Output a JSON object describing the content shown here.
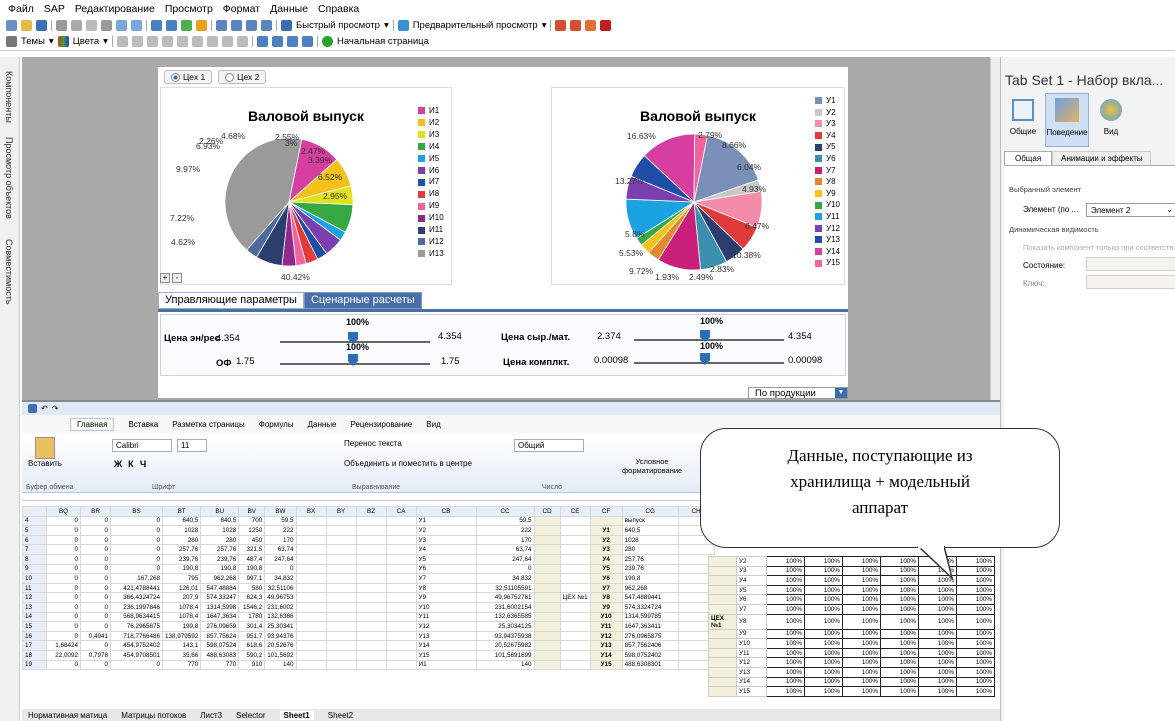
{
  "menu": [
    "Файл",
    "SAP",
    "Редактирование",
    "Просмотр",
    "Формат",
    "Данные",
    "Справка"
  ],
  "toolbar1": {
    "quick_view": "Быстрый просмотр",
    "preview": "Предварительный просмотр"
  },
  "toolbar2": {
    "themes": "Темы",
    "colors": "Цвета",
    "start_page": "Начальная страница"
  },
  "left_panel": [
    "Компоненты",
    "Просмотр объектов",
    "Совместимость"
  ],
  "tabset": {
    "radio1": "Цех 1",
    "radio2": "Цех 2"
  },
  "chart1": {
    "title": "Валовой выпуск",
    "labels": [
      "2.26%",
      "4.68%",
      "2.55%",
      "3%",
      "2.47%",
      "3.39%",
      "6.52%",
      "2.95%",
      "40.42%",
      "4.62%",
      "7.22%",
      "9.97%",
      "6.93%"
    ],
    "legend": [
      "И1",
      "И2",
      "И3",
      "И4",
      "И5",
      "И6",
      "И7",
      "И8",
      "И9",
      "И10",
      "И11",
      "И12",
      "И13"
    ]
  },
  "chart2": {
    "title": "Валовой выпуск",
    "labels": [
      "2.79%",
      "8.66%",
      "6.04%",
      "4.93%",
      "6.47%",
      "10.38%",
      "2.83%",
      "2.49%",
      "1.93%",
      "9.72%",
      "5.53%",
      "5.8%",
      "13.27%",
      "16.63%"
    ],
    "legend": [
      "У1",
      "У2",
      "У3",
      "У4",
      "У5",
      "У6",
      "У7",
      "У8",
      "У9",
      "У10",
      "У11",
      "У12",
      "У13",
      "У14",
      "У15"
    ]
  },
  "chart_data": [
    {
      "type": "pie",
      "title": "Валовой выпуск",
      "categories": [
        "И1",
        "И2",
        "И3",
        "И4",
        "И5",
        "И6",
        "И7",
        "И8",
        "И9",
        "И10",
        "И11",
        "И12",
        "И13"
      ],
      "values": [
        9.97,
        7.22,
        4.62,
        6.93,
        2.26,
        4.68,
        2.55,
        3,
        2.47,
        3.39,
        6.52,
        2.95,
        40.42
      ],
      "colors": [
        "#d63fa0",
        "#f2c21b",
        "#e2e21b",
        "#38a845",
        "#1aa3e0",
        "#7b3fb0",
        "#1f4ea8",
        "#e23b3b",
        "#f0649e",
        "#8e2a8e",
        "#2c3e70",
        "#4d6a9a",
        "#9a9a9a"
      ]
    },
    {
      "type": "pie",
      "title": "Валовой выпуск",
      "categories": [
        "У1",
        "У2",
        "У3",
        "У4",
        "У5",
        "У6",
        "У7",
        "У8",
        "У9",
        "У10",
        "У11",
        "У12",
        "У13",
        "У14",
        "У15"
      ],
      "values": [
        16.63,
        2.79,
        8.66,
        6.04,
        4.93,
        6.47,
        10.38,
        2.83,
        2.49,
        1.93,
        9.72,
        5.53,
        5.8,
        13.27,
        3.03
      ],
      "colors": [
        "#7a8fb8",
        "#c8c8c8",
        "#f28ca8",
        "#e03b3b",
        "#2c3e70",
        "#3d8fb0",
        "#c71f7a",
        "#e28a2b",
        "#f2c21b",
        "#38a845",
        "#1aa3e0",
        "#7b3fb0",
        "#1f4ea8",
        "#d63fa0",
        "#f0649e"
      ]
    }
  ],
  "ctrl": {
    "tab1": "Управляющие параметры",
    "tab2": "Сценарные расчеты",
    "pct": "100%",
    "s1_label": "Цена эн/рес",
    "s1_min": "4.354",
    "s1_max": "4.354",
    "s2_label": "ОФ",
    "s2_min": "1.75",
    "s2_max": "1.75",
    "s3_label": "Цена сыр./мат.",
    "s3_min": "2.374",
    "s3_max": "4.354",
    "s4_label": "Цена комплкт.",
    "s4_min": "0.00098",
    "s4_max": "0.00098",
    "dropdown": "По продукции"
  },
  "rpanel": {
    "title": "Tab Set 1 - Набор вкла...",
    "tab_general": "Общие",
    "tab_behavior": "Поведение",
    "tab_view": "Вид",
    "sub1": "Общая",
    "sub2": "Анимации и эффекты",
    "sel_elem": "Выбранный элемент",
    "elem_label": "Элемент (по ...",
    "elem_value": "Элемент 2",
    "dyn": "Динамическая видимость",
    "show_only": "Показать компонент только при соответств.",
    "state": "Состояние:",
    "key": "Ключ:"
  },
  "excel": {
    "tabs": [
      "Главная",
      "Вставка",
      "Разметка страницы",
      "Формулы",
      "Данные",
      "Рецензирование",
      "Вид"
    ],
    "paste": "Вставить",
    "font": "Calibri",
    "size": "11",
    "wrap": "Перенос текста",
    "merge": "Объединить и поместить в центре",
    "format": "Общий",
    "cond": "Условное форматирование",
    "groups": [
      "Буфер обмена",
      "Шрифт",
      "Выравнивание",
      "Число"
    ],
    "cols": [
      "BQ",
      "BR",
      "BS",
      "BT",
      "BU",
      "BV",
      "BW",
      "BX",
      "BY",
      "BZ",
      "CA",
      "CB",
      "CC",
      "CD",
      "CE",
      "CF",
      "CG",
      "CH"
    ],
    "rows": [
      [
        "4",
        "0",
        "0",
        "0",
        "640,5",
        "640,5",
        "700",
        "59,5",
        "",
        "",
        "",
        "",
        "У1",
        "59,5",
        "",
        "",
        "",
        "выпуск",
        ""
      ],
      [
        "5",
        "0",
        "0",
        "0",
        "1028",
        "1028",
        "1250",
        "222",
        "",
        "",
        "",
        "",
        "У2",
        "222",
        "",
        "",
        "У1",
        "640,5",
        ""
      ],
      [
        "6",
        "0",
        "0",
        "0",
        "280",
        "280",
        "450",
        "170",
        "",
        "",
        "",
        "",
        "У3",
        "170",
        "",
        "",
        "У2",
        "1028",
        ""
      ],
      [
        "7",
        "0",
        "0",
        "0",
        "257,76",
        "257,76",
        "321,5",
        "63,74",
        "",
        "",
        "",
        "",
        "У4",
        "63,74",
        "",
        "",
        "У3",
        "280",
        ""
      ],
      [
        "8",
        "0",
        "0",
        "0",
        "239,76",
        "239,76",
        "487,4",
        "247,64",
        "",
        "",
        "",
        "",
        "У5",
        "247,64",
        "",
        "",
        "У4",
        "257,76",
        ""
      ],
      [
        "9",
        "0",
        "0",
        "0",
        "190,8",
        "190,8",
        "190,8",
        "0",
        "",
        "",
        "",
        "",
        "У6",
        "0",
        "",
        "",
        "У5",
        "239,76",
        ""
      ],
      [
        "10",
        "0",
        "0",
        "167,268",
        "795",
        "962,268",
        "997,1",
        "34,832",
        "",
        "",
        "",
        "",
        "У7",
        "34,832",
        "",
        "",
        "У6",
        "190,8",
        ""
      ],
      [
        "11",
        "0",
        "0",
        "421,4788441",
        "126,01",
        "547,48884",
        "580",
        "32,51106",
        "",
        "",
        "",
        "",
        "У8",
        "32,51105591",
        "",
        "",
        "У7",
        "962,268",
        ""
      ],
      [
        "12",
        "0",
        "0",
        "366,4324724",
        "207,9",
        "574,33247",
        "624,3",
        "49,96753",
        "",
        "",
        "",
        "",
        "У9",
        "49,96752761",
        "",
        "ЦЕХ №1",
        "У8",
        "547,4889441",
        ""
      ],
      [
        "13",
        "0",
        "0",
        "236,1997846",
        "1078,4",
        "1314,5998",
        "1546,2",
        "231,6002",
        "",
        "",
        "",
        "",
        "У10",
        "231,6002154",
        "",
        "",
        "У9",
        "574,3324724",
        ""
      ],
      [
        "14",
        "0",
        "0",
        "568,9634415",
        "1078,4",
        "1647,3634",
        "1780",
        "132,6366",
        "",
        "",
        "",
        "",
        "У11",
        "132,6365585",
        "",
        "",
        "У10",
        "1314,599785",
        ""
      ],
      [
        "15",
        "0",
        "0",
        "76,2965875",
        "199,8",
        "276,09659",
        "301,4",
        "25,30341",
        "",
        "",
        "",
        "",
        "У12",
        "25,3034125",
        "",
        "",
        "У11",
        "1647,363411",
        ""
      ],
      [
        "16",
        "0",
        "0,4941",
        "718,7766486",
        "138,979592",
        "857,75624",
        "951,7",
        "93,94376",
        "",
        "",
        "",
        "",
        "У13",
        "93,94375938",
        "",
        "",
        "У12",
        "276,0965875",
        ""
      ],
      [
        "17",
        "1,68424",
        "0",
        "454,9752402",
        "143,1",
        "598,07524",
        "618,6",
        "20,52676",
        "",
        "",
        "",
        "",
        "У14",
        "20,52675982",
        "",
        "",
        "У13",
        "857,7562406",
        ""
      ],
      [
        "18",
        "22,0092",
        "0,7978",
        "454,9708501",
        "35,66",
        "488,63083",
        "590,2",
        "101,5692",
        "",
        "",
        "",
        "",
        "У15",
        "101,5691699",
        "",
        "",
        "У14",
        "598,0752402",
        ""
      ],
      [
        "19",
        "0",
        "0",
        "0",
        "770",
        "770",
        "910",
        "140",
        "",
        "",
        "",
        "",
        "И1",
        "140",
        "",
        "",
        "У15",
        "488,6308301",
        ""
      ]
    ],
    "sheets": [
      "Нормативная матица",
      "Матрицы потоков",
      "Лист3",
      "Selector",
      "Sheet1",
      "Sheet2"
    ]
  },
  "pct_cell": "100%",
  "right_rows": [
    "У2",
    "У3",
    "У4",
    "У5",
    "У6",
    "У7",
    "У8",
    "У9",
    "У10",
    "У11",
    "У12",
    "У13",
    "У14",
    "У15"
  ],
  "right_label": "ЦЕХ №1",
  "callout": {
    "line1": "Данные, поступающие из",
    "line2": "хранилища + модельный",
    "line3": "аппарат"
  }
}
